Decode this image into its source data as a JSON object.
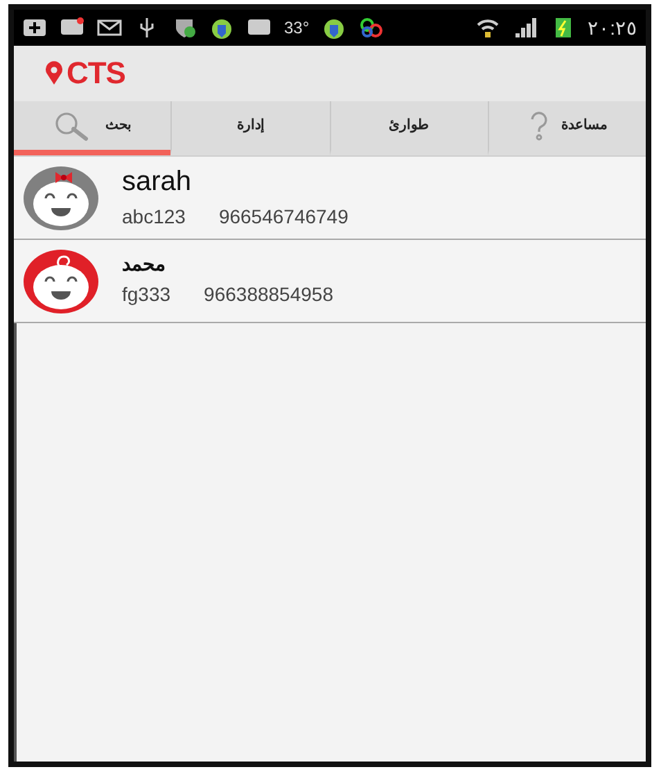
{
  "status_bar": {
    "temperature": "33°",
    "time": "٢٠:٢٥"
  },
  "app_bar": {
    "logo": "CTS"
  },
  "tabs": [
    {
      "label": "مساعدة",
      "kind": "help",
      "selected": false
    },
    {
      "label": "طوارئ",
      "kind": "plain",
      "selected": false
    },
    {
      "label": "إدارة",
      "kind": "plain",
      "selected": false
    },
    {
      "label": "بحث",
      "kind": "search",
      "selected": true
    }
  ],
  "contacts": [
    {
      "name": "sarah",
      "code": "abc123",
      "phone": "966546746749",
      "kind": "girl",
      "color": "#808080"
    },
    {
      "name": "محمد",
      "code": "fg333",
      "phone": "966388854958",
      "kind": "boy",
      "color": "#e02028"
    }
  ]
}
